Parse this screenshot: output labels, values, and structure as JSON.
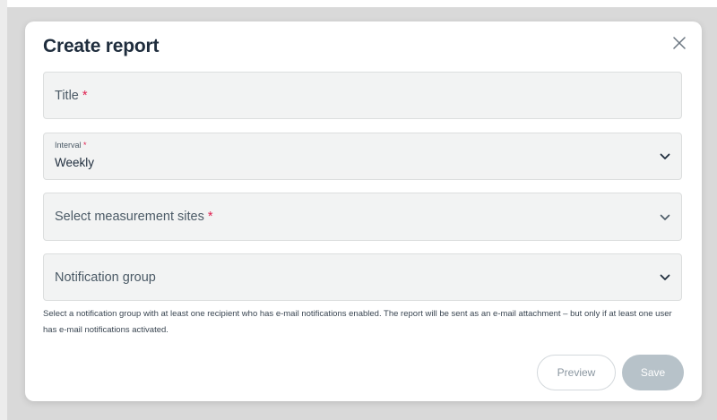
{
  "dialog": {
    "title": "Create report",
    "close_icon": "close-icon"
  },
  "form": {
    "title_field": {
      "label": "Title",
      "required_mark": "*"
    },
    "interval_field": {
      "label": "Interval",
      "required_mark": "*",
      "value": "Weekly",
      "icon": "chevron-down-icon"
    },
    "sites_field": {
      "label": "Select measurement sites",
      "required_mark": "*",
      "icon": "chevron-down-icon"
    },
    "notification_field": {
      "label": "Notification group",
      "icon": "chevron-down-icon"
    },
    "helper_text": "Select a notification group with at least one recipient who has e-mail notifications enabled. The report will be sent as an e-mail attachment – but only if at least one user has e-mail notifications activated."
  },
  "actions": {
    "preview_label": "Preview",
    "save_label": "Save"
  },
  "colors": {
    "required": "#e0204f",
    "field_bg": "#f2f3f3",
    "save_disabled": "#b7c2c9",
    "title_text": "#1f2d3d"
  }
}
